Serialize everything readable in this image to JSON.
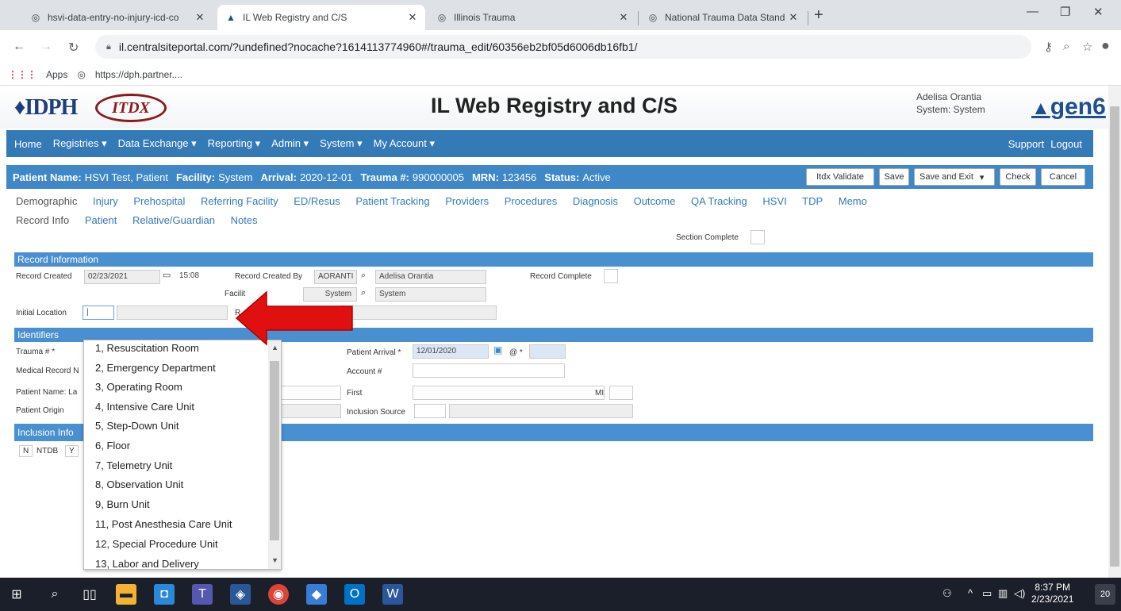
{
  "browser": {
    "tabs": [
      {
        "label": "hsvi-data-entry-no-injury-icd-co",
        "icon": "globe-icon",
        "active": false
      },
      {
        "label": "IL Web Registry and C/S",
        "icon": "gen6-favicon",
        "active": true
      },
      {
        "label": "Illinois Trauma",
        "icon": "globe-icon",
        "active": false
      },
      {
        "label": "National Trauma Data Standard",
        "icon": "globe-icon",
        "active": false
      }
    ],
    "url": "il.centralsiteportal.com/?undefined?nocache?1614113774960#/trauma_edit/60356eb2bf05d6006db16fb1/",
    "bookmarks": [
      "Apps",
      "https://dph.partner...."
    ]
  },
  "app": {
    "logo_left": "IDPH",
    "logo_itdx": "ITDX",
    "title": "IL Web Registry and C/S",
    "user_name": "Adelisa Orantia",
    "user_system": "System: System",
    "logo_right": "gen6"
  },
  "nav": {
    "items": [
      "Home",
      "Registries ▾",
      "Data Exchange ▾",
      "Reporting ▾",
      "Admin ▾",
      "System ▾",
      "My Account ▾"
    ],
    "support": "Support",
    "logout": "Logout"
  },
  "patient": {
    "name_label": "Patient Name:",
    "name": "HSVI Test, Patient",
    "facility_label": "Facility:",
    "facility": "System",
    "arrival_label": "Arrival:",
    "arrival": "2020-12-01",
    "trauma_label": "Trauma #:",
    "trauma": "990000005",
    "mrn_label": "MRN:",
    "mrn": "123456",
    "status_label": "Status:",
    "status": "Active",
    "buttons": {
      "validate": "Itdx Validate",
      "save": "Save",
      "save_exit": "Save and Exit",
      "check": "Check",
      "cancel": "Cancel"
    }
  },
  "tabs_row1": [
    "Demographic",
    "Injury",
    "Prehospital",
    "Referring Facility",
    "ED/Resus",
    "Patient Tracking",
    "Providers",
    "Procedures",
    "Diagnosis",
    "Outcome",
    "QA Tracking",
    "HSVI",
    "TDP",
    "Memo"
  ],
  "tabs_row2": [
    "Record Info",
    "Patient",
    "Relative/Guardian",
    "Notes"
  ],
  "section_complete": "Section Complete",
  "record_info": {
    "header": "Record Information",
    "created_label": "Record Created",
    "created_date": "02/23/2021",
    "created_time": "15:08",
    "created_by_label": "Record Created By",
    "created_by_id": "AORANTI",
    "created_by_name": "Adelisa Orantia",
    "complete_label": "Record Complete",
    "facility_label": "Facilit",
    "facility_id": "System",
    "facility_name": "System",
    "initial_location_label": "Initial Location",
    "initial_location_value": "|",
    "r_label": "R"
  },
  "identifiers": {
    "header": "Identifiers",
    "trauma_label": "Trauma # *",
    "mrn_label": "Medical Record N",
    "name_label": "Patient Name: La",
    "origin_label": "Patient Origin",
    "arrival_label": "Patient Arrival *",
    "arrival_value": "12/01/2020",
    "at_label": "@ *",
    "account_label": "Account #",
    "first_label": "First",
    "mi_label": "MI",
    "inclusion_source_label": "Inclusion Source"
  },
  "inclusion": {
    "header": "Inclusion Info",
    "n": "N",
    "ntdb": "NTDB",
    "y": "Y"
  },
  "dropdown": {
    "options": [
      "1, Resuscitation Room",
      "2, Emergency Department",
      "3, Operating Room",
      "4, Intensive Care Unit",
      "5, Step-Down Unit",
      "6, Floor",
      "7, Telemetry Unit",
      "8, Observation Unit",
      "9, Burn Unit",
      "11, Post Anesthesia Care Unit",
      "12, Special Procedure Unit",
      "13, Labor and Delivery"
    ]
  },
  "taskbar": {
    "time": "8:37 PM",
    "date": "2/23/2021",
    "notifications": "20"
  },
  "colors": {
    "nav_blue": "#337ab7",
    "section_blue": "#4a8fd0",
    "arrow_red": "#e01010"
  }
}
